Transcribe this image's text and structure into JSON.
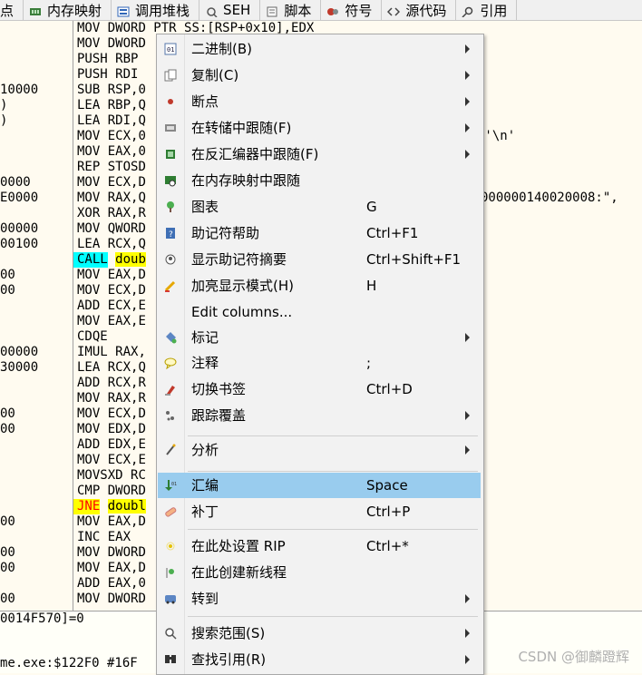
{
  "tabs": [
    {
      "label": "点",
      "icon": "breakpoint-icon"
    },
    {
      "label": "内存映射",
      "icon": "memory-icon"
    },
    {
      "label": "调用堆栈",
      "icon": "callstack-icon"
    },
    {
      "label": "SEH",
      "icon": "seh-icon"
    },
    {
      "label": "脚本",
      "icon": "script-icon"
    },
    {
      "label": "符号",
      "icon": "symbol-icon"
    },
    {
      "label": "源代码",
      "icon": "source-icon"
    },
    {
      "label": "引用",
      "icon": "search-icon"
    }
  ],
  "addresses": [
    {
      "text": "10000",
      "row": 4
    },
    {
      "text": ")",
      "row": 5
    },
    {
      "text": ")",
      "row": 6
    },
    {
      "text": "0000",
      "row": 10
    },
    {
      "text": "E0000",
      "row": 11
    },
    {
      "text": "00000",
      "row": 13
    },
    {
      "text": "00100",
      "row": 14
    },
    {
      "text": "00",
      "row": 16
    },
    {
      "text": "00",
      "row": 17
    },
    {
      "text": "00000",
      "row": 21
    },
    {
      "text": "30000",
      "row": 22
    },
    {
      "text": "00",
      "row": 25
    },
    {
      "text": "00",
      "row": 26
    },
    {
      "text": "00",
      "row": 32
    },
    {
      "text": "00",
      "row": 34
    },
    {
      "text": "00",
      "row": 35
    },
    {
      "text": "00",
      "row": 37
    }
  ],
  "instructions": [
    {
      "mnemonic": "MOV",
      "operands": "DWORD PTR SS:[RSP+0x10],EDX"
    },
    {
      "mnemonic": "MOV",
      "operands": "DWORD"
    },
    {
      "mnemonic": "PUSH",
      "operands": "RBP"
    },
    {
      "mnemonic": "PUSH",
      "operands": "RDI"
    },
    {
      "mnemonic": "SUB",
      "operands": "RSP,0"
    },
    {
      "mnemonic": "LEA",
      "operands": "RBP,Q"
    },
    {
      "mnemonic": "LEA",
      "operands": "RDI,Q"
    },
    {
      "mnemonic": "MOV",
      "operands": "ECX,0"
    },
    {
      "mnemonic": "MOV",
      "operands": "EAX,0"
    },
    {
      "mnemonic": "REP",
      "operands": "STOSD"
    },
    {
      "mnemonic": "MOV",
      "operands": "ECX,D"
    },
    {
      "mnemonic": "MOV",
      "operands": "RAX,Q"
    },
    {
      "mnemonic": "XOR",
      "operands": "RAX,R"
    },
    {
      "mnemonic": "MOV",
      "operands": "QWORD"
    },
    {
      "mnemonic": "LEA",
      "operands": "RCX,Q"
    },
    {
      "mnemonic": "CALL",
      "operands": "doub"
    },
    {
      "mnemonic": "MOV",
      "operands": "EAX,D"
    },
    {
      "mnemonic": "MOV",
      "operands": "ECX,D"
    },
    {
      "mnemonic": "ADD",
      "operands": "ECX,E"
    },
    {
      "mnemonic": "MOV",
      "operands": "EAX,E"
    },
    {
      "mnemonic": "CDQE",
      "operands": ""
    },
    {
      "mnemonic": "IMUL",
      "operands": "RAX,"
    },
    {
      "mnemonic": "LEA",
      "operands": "RCX,Q"
    },
    {
      "mnemonic": "ADD",
      "operands": "RCX,R"
    },
    {
      "mnemonic": "MOV",
      "operands": "RAX,R"
    },
    {
      "mnemonic": "MOV",
      "operands": "ECX,D"
    },
    {
      "mnemonic": "MOV",
      "operands": "EDX,D"
    },
    {
      "mnemonic": "ADD",
      "operands": "EDX,E"
    },
    {
      "mnemonic": "MOV",
      "operands": "ECX,E"
    },
    {
      "mnemonic": "MOVSXD",
      "operands": "RC"
    },
    {
      "mnemonic": "CMP",
      "operands": "DWORD"
    },
    {
      "mnemonic": "JNE",
      "operands": "doubl"
    },
    {
      "mnemonic": "MOV",
      "operands": "EAX,D"
    },
    {
      "mnemonic": "INC",
      "operands": "EAX"
    },
    {
      "mnemonic": "MOV",
      "operands": "DWORD"
    },
    {
      "mnemonic": "MOV",
      "operands": "EAX,D"
    },
    {
      "mnemonic": "ADD",
      "operands": "EAX,0"
    },
    {
      "mnemonic": "MOV",
      "operands": "DWORD"
    }
  ],
  "comments": [
    {
      "text": ":'\\n'",
      "row": 7
    },
    {
      "text": "000000140020008:\",",
      "row": 11
    }
  ],
  "info": {
    "line1": "0014F570]=0",
    "line2": "me.exe:$122F0 #16F"
  },
  "context_menu": {
    "items": [
      {
        "label": "二进制(B)",
        "shortcut": "",
        "submenu": true,
        "icon": "binary-icon"
      },
      {
        "label": "复制(C)",
        "shortcut": "",
        "submenu": true,
        "icon": "copy-icon"
      },
      {
        "label": "断点",
        "shortcut": "",
        "submenu": true,
        "icon": "breakpoint-icon"
      },
      {
        "label": "在转储中跟随(F)",
        "shortcut": "",
        "submenu": true,
        "icon": "dump-icon"
      },
      {
        "label": "在反汇编器中跟随(F)",
        "shortcut": "",
        "submenu": true,
        "icon": "cpu-icon"
      },
      {
        "label": "在内存映射中跟随",
        "shortcut": "",
        "submenu": false,
        "icon": "memory-map-icon"
      },
      {
        "label": "图表",
        "shortcut": "G",
        "submenu": false,
        "icon": "graph-icon"
      },
      {
        "label": "助记符帮助",
        "shortcut": "Ctrl+F1",
        "submenu": false,
        "icon": "help-icon"
      },
      {
        "label": "显示助记符摘要",
        "shortcut": "Ctrl+Shift+F1",
        "submenu": false,
        "icon": "summary-icon"
      },
      {
        "label": "加亮显示模式(H)",
        "shortcut": "H",
        "submenu": false,
        "icon": "highlight-icon"
      },
      {
        "label": "Edit columns...",
        "shortcut": "",
        "submenu": false,
        "icon": ""
      },
      {
        "label": "标记",
        "shortcut": "",
        "submenu": true,
        "icon": "label-icon"
      },
      {
        "label": "注释",
        "shortcut": ";",
        "submenu": false,
        "icon": "comment-icon"
      },
      {
        "label": "切换书签",
        "shortcut": "Ctrl+D",
        "submenu": false,
        "icon": "bookmark-icon"
      },
      {
        "label": "跟踪覆盖",
        "shortcut": "",
        "submenu": true,
        "icon": "trace-icon"
      },
      {
        "label": "分析",
        "shortcut": "",
        "submenu": true,
        "icon": "analysis-icon"
      },
      {
        "label": "汇编",
        "shortcut": "Space",
        "submenu": false,
        "icon": "assemble-icon",
        "selected": true
      },
      {
        "label": "补丁",
        "shortcut": "Ctrl+P",
        "submenu": false,
        "icon": "patch-icon"
      },
      {
        "label": "在此处设置 RIP",
        "shortcut": "Ctrl+*",
        "submenu": false,
        "icon": "set-rip-icon"
      },
      {
        "label": "在此创建新线程",
        "shortcut": "",
        "submenu": false,
        "icon": "new-thread-icon"
      },
      {
        "label": "转到",
        "shortcut": "",
        "submenu": true,
        "icon": "goto-icon"
      },
      {
        "label": "搜索范围(S)",
        "shortcut": "",
        "submenu": true,
        "icon": "search-scope-icon"
      },
      {
        "label": "查找引用(R)",
        "shortcut": "",
        "submenu": true,
        "icon": "find-references-icon"
      }
    ]
  },
  "watermark": "CSDN @御麟蹬辉"
}
